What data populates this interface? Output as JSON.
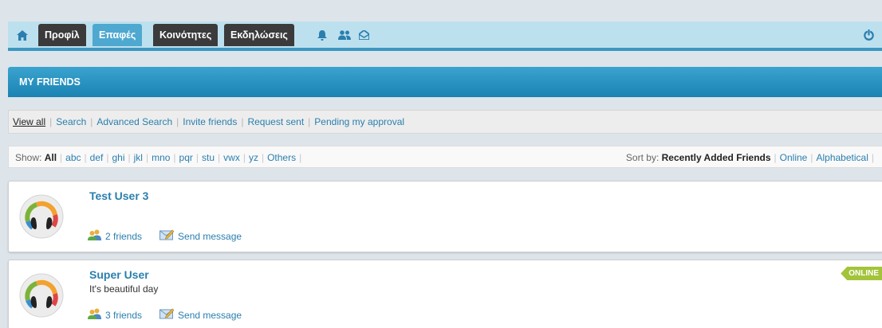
{
  "nav": {
    "tabs": [
      "Προφίλ",
      "Επαφές",
      "Κοινότητες",
      "Εκδηλώσεις"
    ],
    "active_tab": "Επαφές",
    "icons": [
      "home-icon",
      "bell-icon",
      "users-icon",
      "inbox-icon",
      "power-icon"
    ]
  },
  "header": {
    "title": "MY FRIENDS"
  },
  "filter": {
    "links": [
      "View all",
      "Search",
      "Advanced Search",
      "Invite friends",
      "Request sent",
      "Pending my approval"
    ],
    "active": "View all"
  },
  "show": {
    "label": "Show:",
    "all": "All",
    "letters": [
      "abc",
      "def",
      "ghi",
      "jkl",
      "mno",
      "pqr",
      "stu",
      "vwx",
      "yz",
      "Others"
    ]
  },
  "sort": {
    "label": "Sort by:",
    "active": "Recently Added Friends",
    "options": [
      "Online",
      "Alphabetical"
    ]
  },
  "friends": [
    {
      "name": "Test User 3",
      "status": "",
      "friends_count": "2 friends",
      "send_message": "Send message",
      "online": ""
    },
    {
      "name": "Super User",
      "status": "It's beautiful day",
      "friends_count": "3 friends",
      "send_message": "Send message",
      "online": "ONLINE"
    }
  ],
  "colors": {
    "accent": "#2a7fae",
    "nav_bg": "#bde0ee",
    "header": "#2392c2",
    "online": "#a3c43a",
    "dark_tab": "#3b3b3b"
  }
}
